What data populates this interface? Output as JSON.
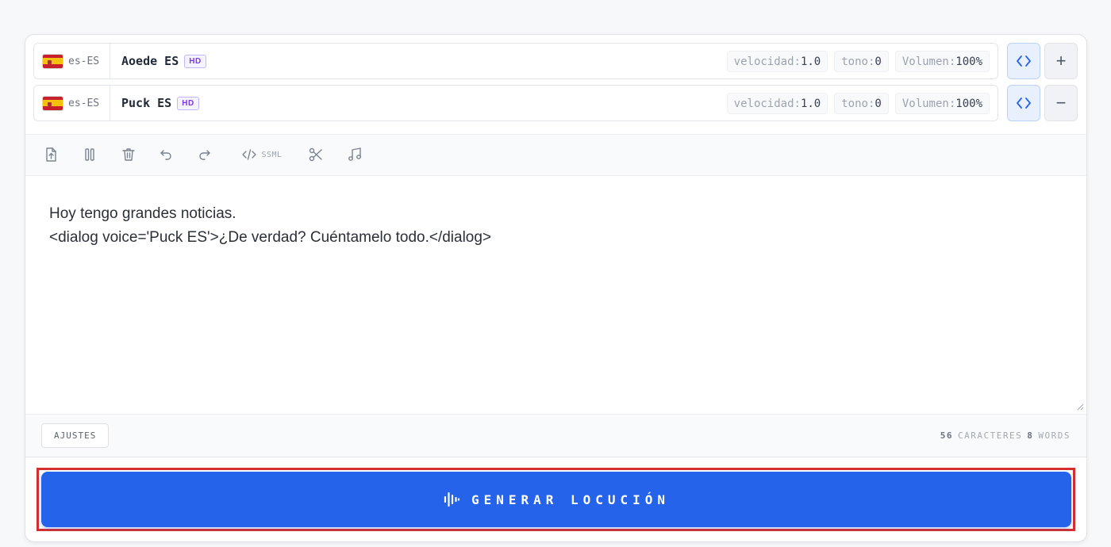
{
  "voices": [
    {
      "locale": "es-ES",
      "name": "Aoede ES",
      "badge": "HD",
      "params": [
        {
          "label": "velocidad:",
          "value": "1.0"
        },
        {
          "label": "tono:",
          "value": "0"
        },
        {
          "label": "Volumen:",
          "value": "100%"
        }
      ],
      "action_symbol": "+"
    },
    {
      "locale": "es-ES",
      "name": "Puck ES",
      "badge": "HD",
      "params": [
        {
          "label": "velocidad:",
          "value": "1.0"
        },
        {
          "label": "tono:",
          "value": "0"
        },
        {
          "label": "Volumen:",
          "value": "100%"
        }
      ],
      "action_symbol": "−"
    }
  ],
  "toolbar": {
    "icons": [
      "upload-file-icon",
      "pause-icon",
      "trash-icon",
      "undo-icon",
      "redo-icon",
      "ssml-code-icon",
      "scissors-icon",
      "music-icon"
    ],
    "ssml_label": "SSML"
  },
  "editor": {
    "lines": [
      "Hoy tengo grandes noticias.",
      "<dialog voice='Puck ES'>¿De verdad? Cuéntamelo todo.</dialog>"
    ]
  },
  "footer": {
    "settings_label": "AJUSTES",
    "char_count": "56",
    "char_label": "CARACTERES",
    "word_count": "8",
    "word_label": "WORDS"
  },
  "generate": {
    "label": "GENERAR LOCUCIÓN",
    "icon": "audio-waveform-icon"
  },
  "colors": {
    "accent": "#2563eb",
    "highlight_outline": "#d32f2f",
    "hd_badge": "#7c3aed"
  }
}
